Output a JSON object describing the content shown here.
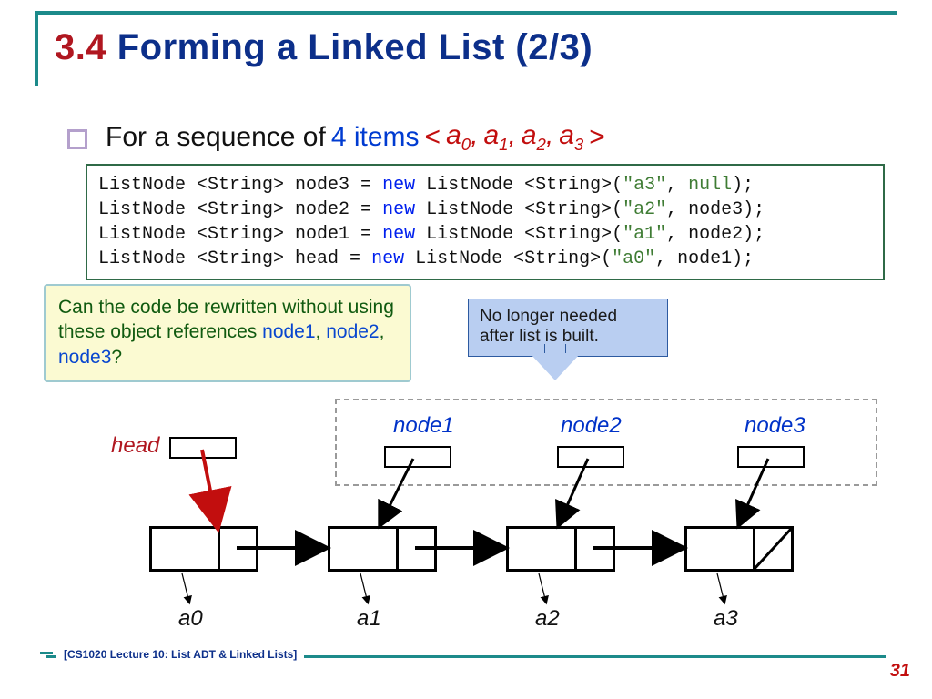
{
  "title": {
    "num": "3.4",
    "txt": "Forming a Linked List (2/3)"
  },
  "bullet": {
    "prefix": "For a sequence of",
    "items": "4 items",
    "seq_open": "<",
    "a0": "a",
    "s0": "0",
    "c0": ",",
    "a1": "a",
    "s1": "1",
    "c1": ",",
    "a2": "a",
    "s2": "2",
    "c2": ",",
    "a3": "a",
    "s3": "3",
    "seq_close": ">"
  },
  "code": {
    "l1a": "ListNode <String> node3 = ",
    "kw1": "new",
    "l1b": " ListNode <String>(",
    "s1": "\"a3\"",
    "l1c": ", ",
    "n1": "null",
    "l1d": ");",
    "l2a": "ListNode <String> node2 = ",
    "kw2": "new",
    "l2b": " ListNode <String>(",
    "s2": "\"a2\"",
    "l2c": ", node3);",
    "l3a": "ListNode <String> node1 = ",
    "kw3": "new",
    "l3b": " ListNode <String>(",
    "s3": "\"a1\"",
    "l3c": ", node2);",
    "l4a": "ListNode <String> head  = ",
    "kw4": "new",
    "l4b": " ListNode <String>(",
    "s4": "\"a0\"",
    "l4c": ", node1);"
  },
  "qbox": {
    "p1": "Can the code be rewritten without using these object references ",
    "r1": "node1",
    "c1": ", ",
    "r2": "node2",
    "c2": ", ",
    "r3": "node3",
    "q": "?"
  },
  "callout": {
    "l1": "No longer needed",
    "l2": "after list is built."
  },
  "labels": {
    "head": "head",
    "node1": "node1",
    "node2": "node2",
    "node3": "node3",
    "a0": "a0",
    "a1": "a1",
    "a2": "a2",
    "a3": "a3"
  },
  "footer": {
    "text": "[CS1020 Lecture 10: List ADT & Linked Lists]",
    "page": "31"
  }
}
